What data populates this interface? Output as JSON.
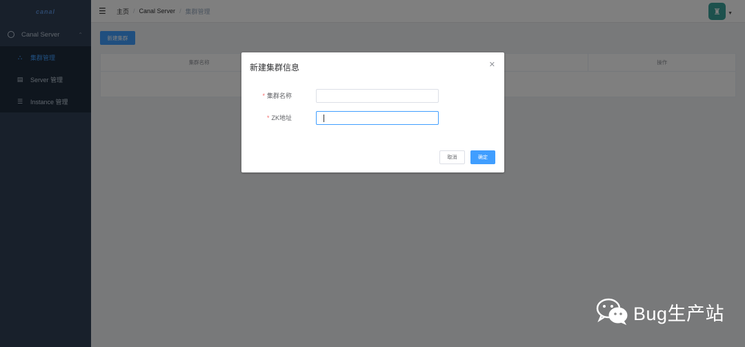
{
  "sidebar": {
    "logo": "canal",
    "group_label": "Canal Server",
    "items": [
      {
        "label": "集群管理",
        "icon": "cluster-icon"
      },
      {
        "label": "Server 管理",
        "icon": "server-icon"
      },
      {
        "label": "Instance 管理",
        "icon": "instance-icon"
      }
    ]
  },
  "navbar": {
    "breadcrumb": [
      "主页",
      "Canal Server",
      "集群管理"
    ]
  },
  "main": {
    "new_button": "新建集群",
    "table_headers": [
      "集群名称",
      "",
      "",
      "操作"
    ]
  },
  "dialog": {
    "title": "新建集群信息",
    "fields": [
      {
        "label": "集群名称",
        "value": "",
        "required": "*"
      },
      {
        "label": "ZK地址",
        "value": "",
        "required": "*"
      }
    ],
    "cancel_label": "取消",
    "ok_label": "确定"
  },
  "watermark": {
    "text": "Bug生产站"
  },
  "colors": {
    "sidebar_bg": "#304156",
    "primary": "#409eff",
    "required": "#f56c6c",
    "overlay": "rgba(0,0,0,0.5)"
  }
}
